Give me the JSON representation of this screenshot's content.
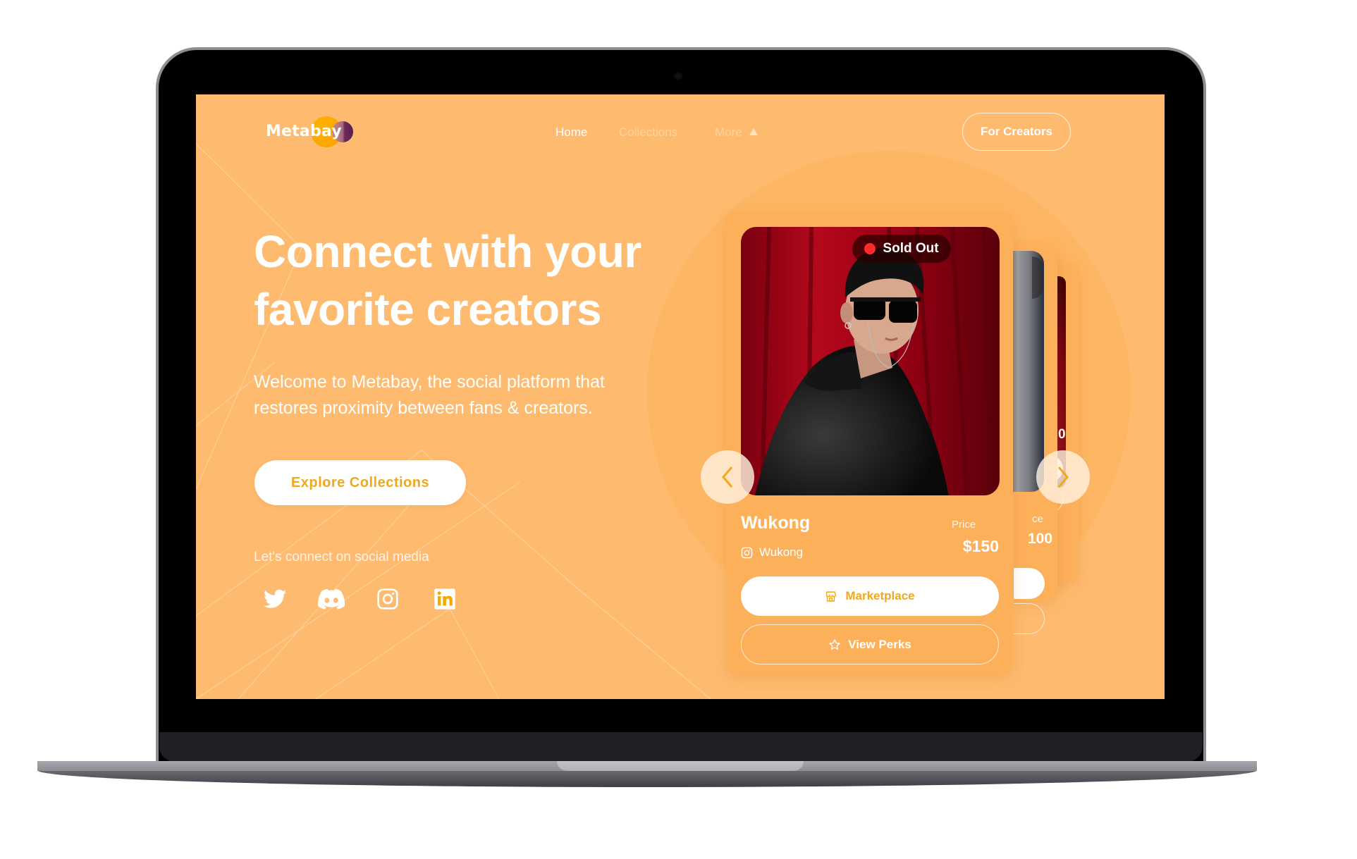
{
  "brand": {
    "name": "Metabay",
    "colors": {
      "screen_bg": "#feba6e",
      "card_bg": "#fdb05a",
      "accent": "#f2a81c",
      "sold_out_dot": "#ff2a2a",
      "logo_orange": "#ffa800",
      "logo_purple": "#6a2a5a"
    }
  },
  "nav": {
    "items": [
      {
        "label": "Home",
        "active": true
      },
      {
        "label": "Collections",
        "active": false
      },
      {
        "label": "More",
        "active": false
      }
    ],
    "more_icon": "triangle-up-icon",
    "cta_label": "For Creators"
  },
  "hero": {
    "headline_line1": "Connect with your",
    "headline_line2": "favorite creators",
    "subtitle_line1": "Welcome to Metabay, the social platform that",
    "subtitle_line2": "restores proximity between fans & creators.",
    "cta_label": "Explore Collections",
    "social_label": "Let's connect on social media",
    "social_icons": [
      "twitter-icon",
      "discord-icon",
      "instagram-icon",
      "linkedin-icon"
    ]
  },
  "carousel": {
    "prev_icon": "chevron-left-icon",
    "next_icon": "chevron-right-icon",
    "cards": [
      {
        "name": "Wukong",
        "handle": "Wukong",
        "handle_icon": "instagram-icon",
        "status": "Sold Out",
        "price_label": "Price",
        "price": "$150",
        "primary_button": "Marketplace",
        "primary_icon": "store-icon",
        "secondary_button": "View Perks",
        "secondary_icon": "star-icon"
      },
      {
        "price_label_partial": "ce",
        "price_partial": "100"
      },
      {
        "price_partial": "0"
      }
    ]
  }
}
